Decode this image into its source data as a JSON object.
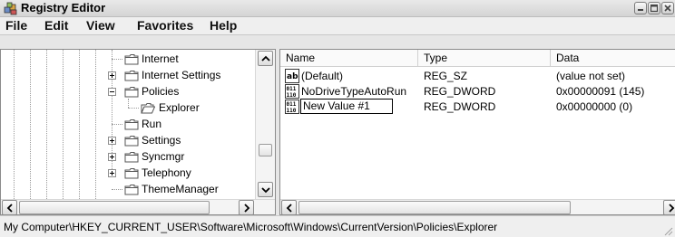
{
  "window": {
    "title": "Registry Editor",
    "icon": "registry-editor-icon",
    "buttons": [
      "minimize",
      "maximize",
      "close"
    ]
  },
  "menu": [
    "File",
    "Edit",
    "View",
    "Favorites",
    "Help"
  ],
  "tree": {
    "nodes": [
      {
        "label": "Internet",
        "expander": "none",
        "icon": "folder-closed"
      },
      {
        "label": "Internet Settings",
        "expander": "plus",
        "icon": "folder-closed"
      },
      {
        "label": "Policies",
        "expander": "minus",
        "icon": "folder-closed"
      },
      {
        "label": "Explorer",
        "expander": "none",
        "icon": "folder-open",
        "selected": true
      },
      {
        "label": "Run",
        "expander": "none",
        "icon": "folder-closed"
      },
      {
        "label": "Settings",
        "expander": "plus",
        "icon": "folder-closed"
      },
      {
        "label": "Syncmgr",
        "expander": "plus",
        "icon": "folder-closed"
      },
      {
        "label": "Telephony",
        "expander": "plus",
        "icon": "folder-closed"
      },
      {
        "label": "ThemeManager",
        "expander": "none",
        "icon": "folder-closed"
      }
    ]
  },
  "list": {
    "columns": [
      "Name",
      "Type",
      "Data"
    ],
    "rows": [
      {
        "name": "(Default)",
        "type": "REG_SZ",
        "data": "(value not set)",
        "icon": "string-value-icon"
      },
      {
        "name": "NoDriveTypeAutoRun",
        "type": "REG_DWORD",
        "data": "0x00000091 (145)",
        "icon": "binary-value-icon"
      },
      {
        "name": "New Value #1",
        "type": "REG_DWORD",
        "data": "0x00000000 (0)",
        "icon": "binary-value-icon",
        "editing": true
      }
    ]
  },
  "status": {
    "path": "My Computer\\HKEY_CURRENT_USER\\Software\\Microsoft\\Windows\\CurrentVersion\\Policies\\Explorer"
  }
}
